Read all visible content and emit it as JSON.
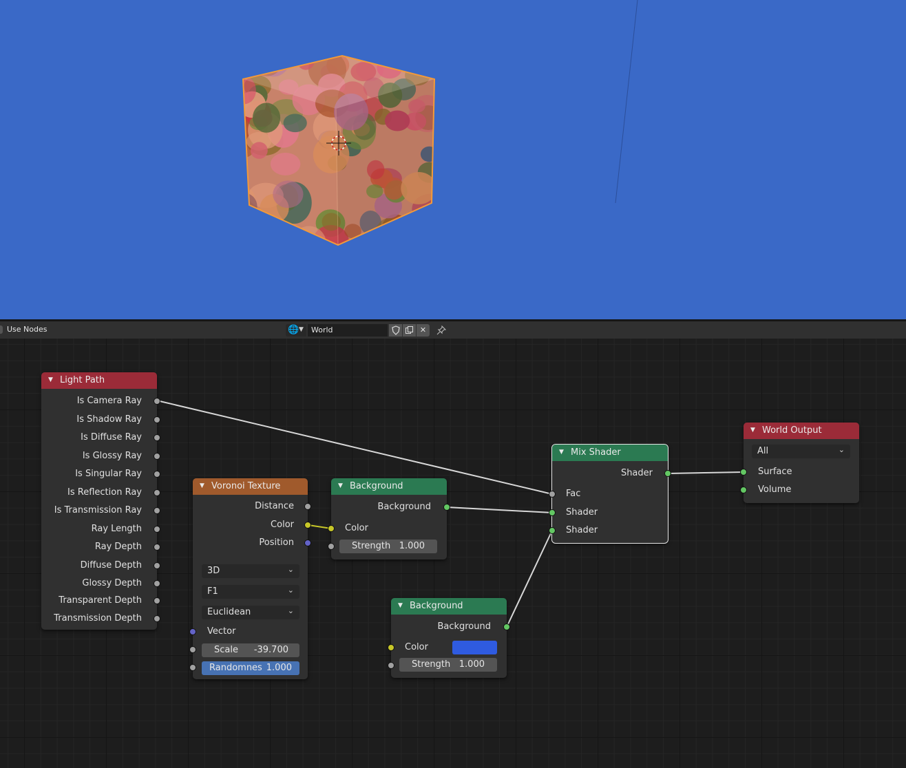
{
  "header": {
    "use_nodes_label": "Use Nodes",
    "world_name": "World",
    "icons": [
      "world-icon",
      "fake-user-shield-icon",
      "duplicate-icon",
      "close-icon",
      "pin-icon"
    ]
  },
  "viewport": {
    "background_color": "#3a69c7",
    "selection_outline_color": "#f29a3a"
  },
  "nodes": {
    "light_path": {
      "title": "Light Path",
      "outputs": [
        "Is Camera Ray",
        "Is Shadow Ray",
        "Is Diffuse Ray",
        "Is Glossy Ray",
        "Is Singular Ray",
        "Is Reflection Ray",
        "Is Transmission Ray",
        "Ray Length",
        "Ray Depth",
        "Diffuse Depth",
        "Glossy Depth",
        "Transparent Depth",
        "Transmission Depth"
      ]
    },
    "voronoi": {
      "title": "Voronoi Texture",
      "outputs": [
        "Distance",
        "Color",
        "Position"
      ],
      "dimensions": "3D",
      "feature": "F1",
      "metric": "Euclidean",
      "vector_label": "Vector",
      "scale_label": "Scale",
      "scale_value": "-39.700",
      "randomness_label": "Randomnes",
      "randomness_value": "1.000"
    },
    "background1": {
      "title": "Background",
      "output": "Background",
      "color_label": "Color",
      "strength_label": "Strength",
      "strength_value": "1.000"
    },
    "background2": {
      "title": "Background",
      "output": "Background",
      "color_label": "Color",
      "color_value": "#2f5be0",
      "strength_label": "Strength",
      "strength_value": "1.000"
    },
    "mix_shader": {
      "title": "Mix Shader",
      "output": "Shader",
      "fac_label": "Fac",
      "shader1_label": "Shader",
      "shader2_label": "Shader"
    },
    "world_output": {
      "title": "World Output",
      "target": "All",
      "surface_label": "Surface",
      "volume_label": "Volume"
    }
  }
}
